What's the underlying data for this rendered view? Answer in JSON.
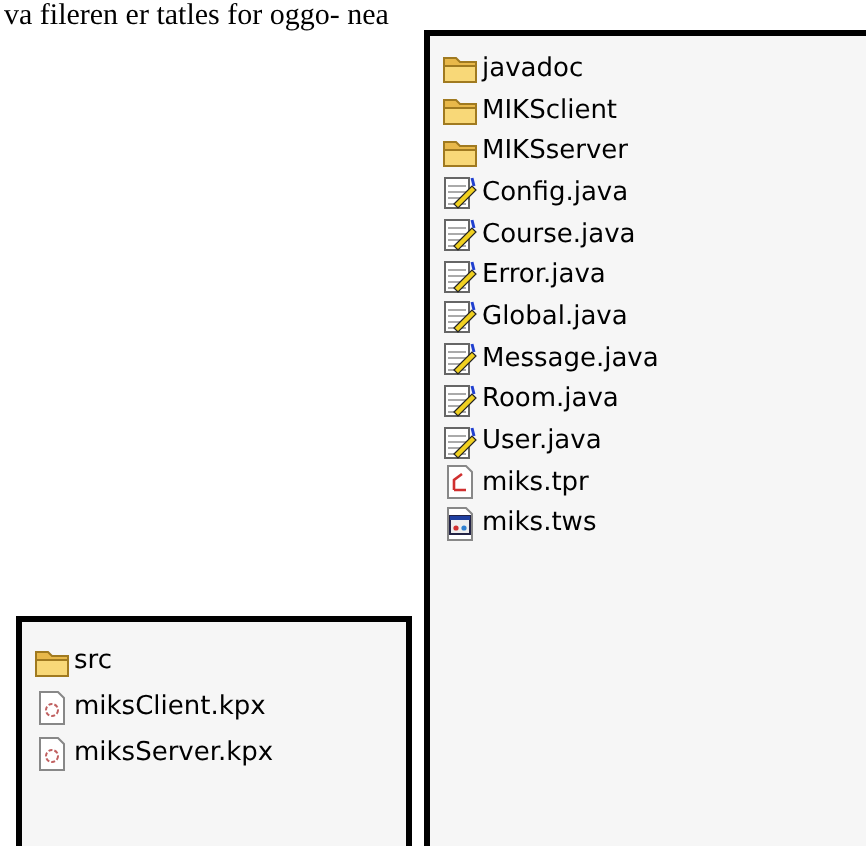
{
  "caption": "va fileren er tatles for oggo- nea",
  "left_panel": {
    "items": [
      {
        "name": "src",
        "kind": "folder"
      },
      {
        "name": "miksClient.kpx",
        "kind": "kpx"
      },
      {
        "name": "miksServer.kpx",
        "kind": "kpx"
      }
    ]
  },
  "right_panel": {
    "items": [
      {
        "name": "javadoc",
        "kind": "folder"
      },
      {
        "name": "MIKSclient",
        "kind": "folder"
      },
      {
        "name": "MIKSserver",
        "kind": "folder"
      },
      {
        "name": "Config.java",
        "kind": "java"
      },
      {
        "name": "Course.java",
        "kind": "java"
      },
      {
        "name": "Error.java",
        "kind": "java"
      },
      {
        "name": "Global.java",
        "kind": "java"
      },
      {
        "name": "Message.java",
        "kind": "java"
      },
      {
        "name": "Room.java",
        "kind": "java"
      },
      {
        "name": "User.java",
        "kind": "java"
      },
      {
        "name": "miks.tpr",
        "kind": "tpr"
      },
      {
        "name": "miks.tws",
        "kind": "tws"
      }
    ]
  }
}
